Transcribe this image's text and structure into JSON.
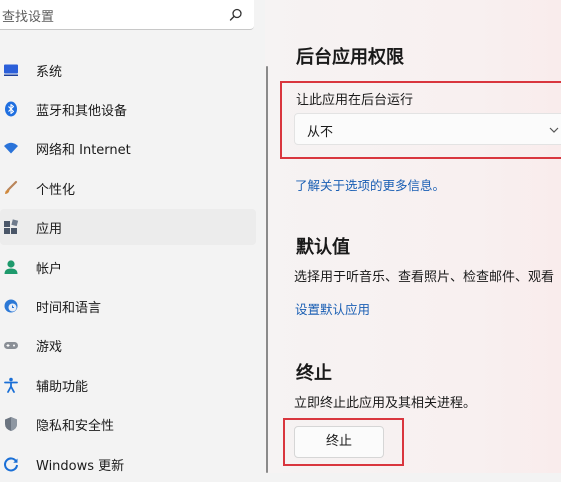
{
  "search": {
    "placeholder": "查找设置",
    "icon": "search-icon"
  },
  "sidebar": {
    "selected_index": 4,
    "items": [
      {
        "label": "系统",
        "icon": "system-icon",
        "color": "#2b5fd9"
      },
      {
        "label": "蓝牙和其他设备",
        "icon": "bluetooth-icon",
        "color": "#1f6fe0"
      },
      {
        "label": "网络和 Internet",
        "icon": "wifi-icon",
        "color": "#2a73d9"
      },
      {
        "label": "个性化",
        "icon": "brush-icon",
        "color": "#c0793c"
      },
      {
        "label": "应用",
        "icon": "apps-icon",
        "color": "#4a5668"
      },
      {
        "label": "帐户",
        "icon": "account-icon",
        "color": "#1e9a6c"
      },
      {
        "label": "时间和语言",
        "icon": "globe-clock-icon",
        "color": "#2b78d6"
      },
      {
        "label": "游戏",
        "icon": "gamepad-icon",
        "color": "#7a7f87"
      },
      {
        "label": "辅助功能",
        "icon": "accessibility-icon",
        "color": "#1a6fd6"
      },
      {
        "label": "隐私和安全性",
        "icon": "shield-icon",
        "color": "#6b7480"
      },
      {
        "label": "Windows 更新",
        "icon": "windows-update-icon",
        "color": "#1a6fd6"
      }
    ]
  },
  "background": {
    "title": "后台应用权限",
    "setting_label": "让此应用在后台运行",
    "dropdown_value": "从不",
    "more_info_link": "了解关于选项的更多信息。"
  },
  "defaults": {
    "title": "默认值",
    "description": "选择用于听音乐、查看照片、检查邮件、观看",
    "link": "设置默认应用"
  },
  "terminate": {
    "title": "终止",
    "description": "立即终止此应用及其相关进程。",
    "button_label": "终止"
  },
  "colors": {
    "link": "#1a5fb4",
    "highlight_box": "#d9363e",
    "selected_nav": "#ececec"
  }
}
